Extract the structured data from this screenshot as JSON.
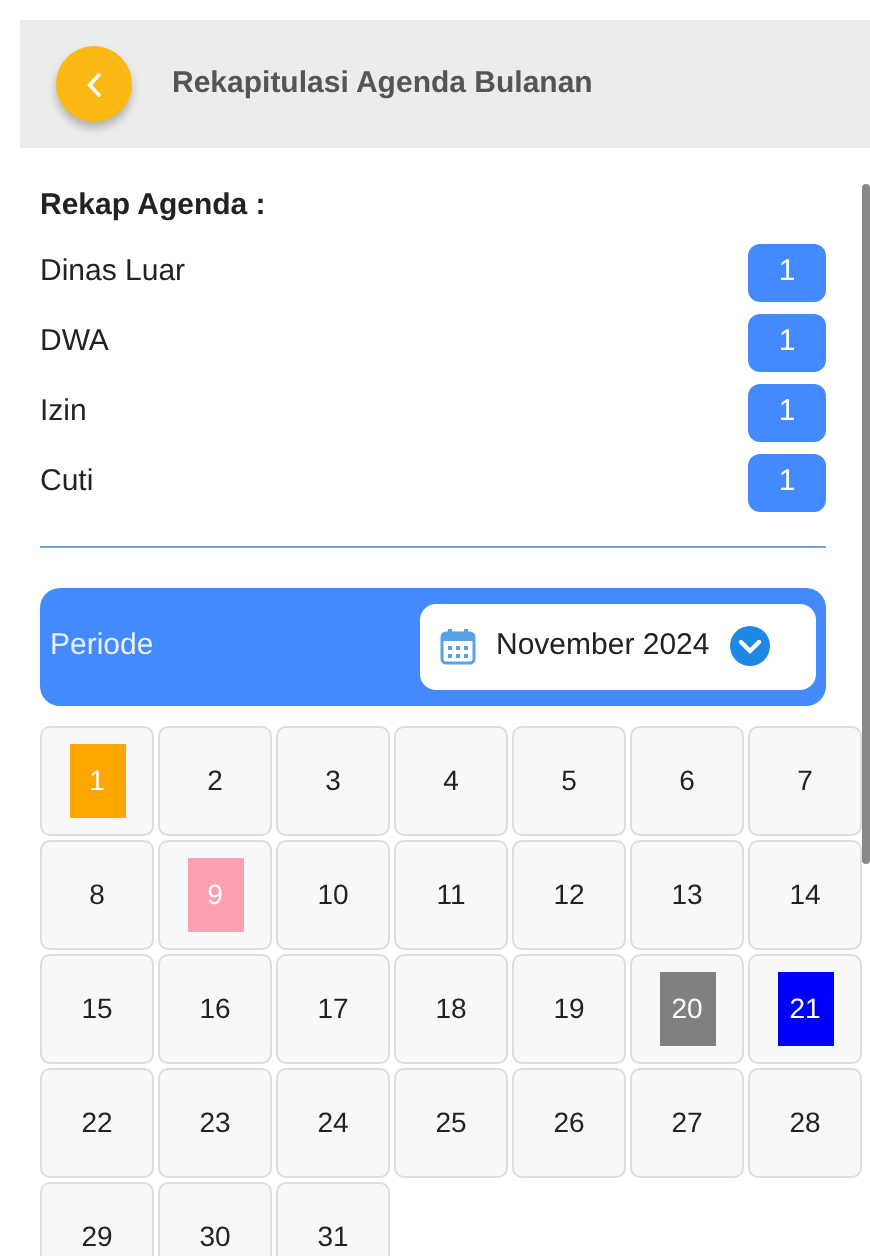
{
  "header": {
    "title": "Rekapitulasi Agenda Bulanan"
  },
  "summary": {
    "heading": "Rekap Agenda :",
    "items": [
      {
        "label": "Dinas Luar",
        "count": "1"
      },
      {
        "label": "DWA",
        "count": "1"
      },
      {
        "label": "Izin",
        "count": "1"
      },
      {
        "label": "Cuti",
        "count": "1"
      }
    ]
  },
  "period": {
    "label": "Periode",
    "value": "November 2024"
  },
  "calendar": {
    "days": [
      {
        "day": "1",
        "color": "#ffa500"
      },
      {
        "day": "2"
      },
      {
        "day": "3"
      },
      {
        "day": "4"
      },
      {
        "day": "5"
      },
      {
        "day": "6"
      },
      {
        "day": "7"
      },
      {
        "day": "8"
      },
      {
        "day": "9",
        "color": "#ff9fb2"
      },
      {
        "day": "10"
      },
      {
        "day": "11"
      },
      {
        "day": "12"
      },
      {
        "day": "13"
      },
      {
        "day": "14"
      },
      {
        "day": "15"
      },
      {
        "day": "16"
      },
      {
        "day": "17"
      },
      {
        "day": "18"
      },
      {
        "day": "19"
      },
      {
        "day": "20",
        "color": "#808080"
      },
      {
        "day": "21",
        "color": "#0000ff"
      },
      {
        "day": "22"
      },
      {
        "day": "23"
      },
      {
        "day": "24"
      },
      {
        "day": "25"
      },
      {
        "day": "26"
      },
      {
        "day": "27"
      },
      {
        "day": "28"
      },
      {
        "day": "29"
      },
      {
        "day": "30"
      },
      {
        "day": "31"
      }
    ]
  }
}
